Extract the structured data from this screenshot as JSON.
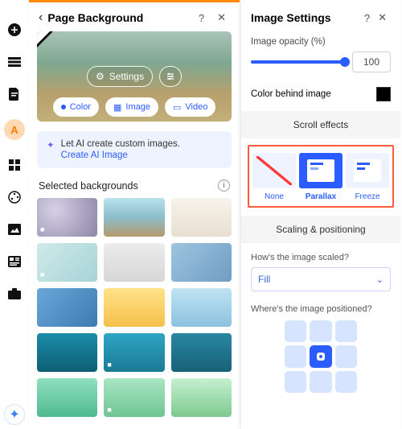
{
  "rail": {
    "ai_label": "A"
  },
  "mid": {
    "title": "Page Background",
    "help": "?",
    "close": "✕",
    "settings_btn": "Settings",
    "tabs": {
      "color": "Color",
      "image": "Image",
      "video": "Video"
    },
    "ai_card": {
      "text": "Let AI create custom images.",
      "link": "Create AI Image"
    },
    "selected_label": "Selected backgrounds"
  },
  "right": {
    "title": "Image Settings",
    "help": "?",
    "close": "✕",
    "opacity_label": "Image opacity (%)",
    "opacity_value": "100",
    "color_behind_label": "Color behind image",
    "color_behind_value": "#000000",
    "scroll_header": "Scroll effects",
    "fx": {
      "none": "None",
      "parallax": "Parallax",
      "freeze": "Freeze"
    },
    "scaling_header": "Scaling & positioning",
    "scale_label": "How's the image scaled?",
    "scale_value": "Fill",
    "position_label": "Where's the image positioned?"
  }
}
